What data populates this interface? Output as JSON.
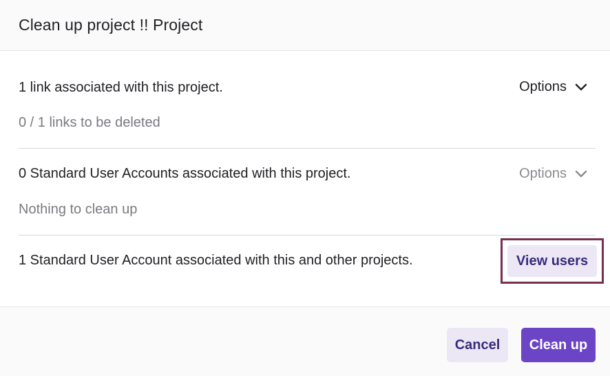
{
  "dialog": {
    "title": "Clean up project !! Project"
  },
  "sections": [
    {
      "text": "1 link associated with this project.",
      "subtext": "0 / 1 links to be deleted",
      "options_label": "Options",
      "options_icon": "chevron-down-icon",
      "options_enabled": true
    },
    {
      "text": "0 Standard User Accounts associated with this project.",
      "subtext": "Nothing to clean up",
      "options_label": "Options",
      "options_icon": "chevron-down-icon",
      "options_enabled": false
    },
    {
      "text": "1 Standard User Account associated with this and other projects.",
      "button_label": "View users"
    }
  ],
  "footer": {
    "cancel_label": "Cancel",
    "cleanup_label": "Clean up"
  },
  "colors": {
    "accent": "#6b45c6",
    "secondary_bg": "#ece7f5",
    "secondary_text": "#3b2a7a",
    "highlight_border": "#7b2c4f"
  }
}
